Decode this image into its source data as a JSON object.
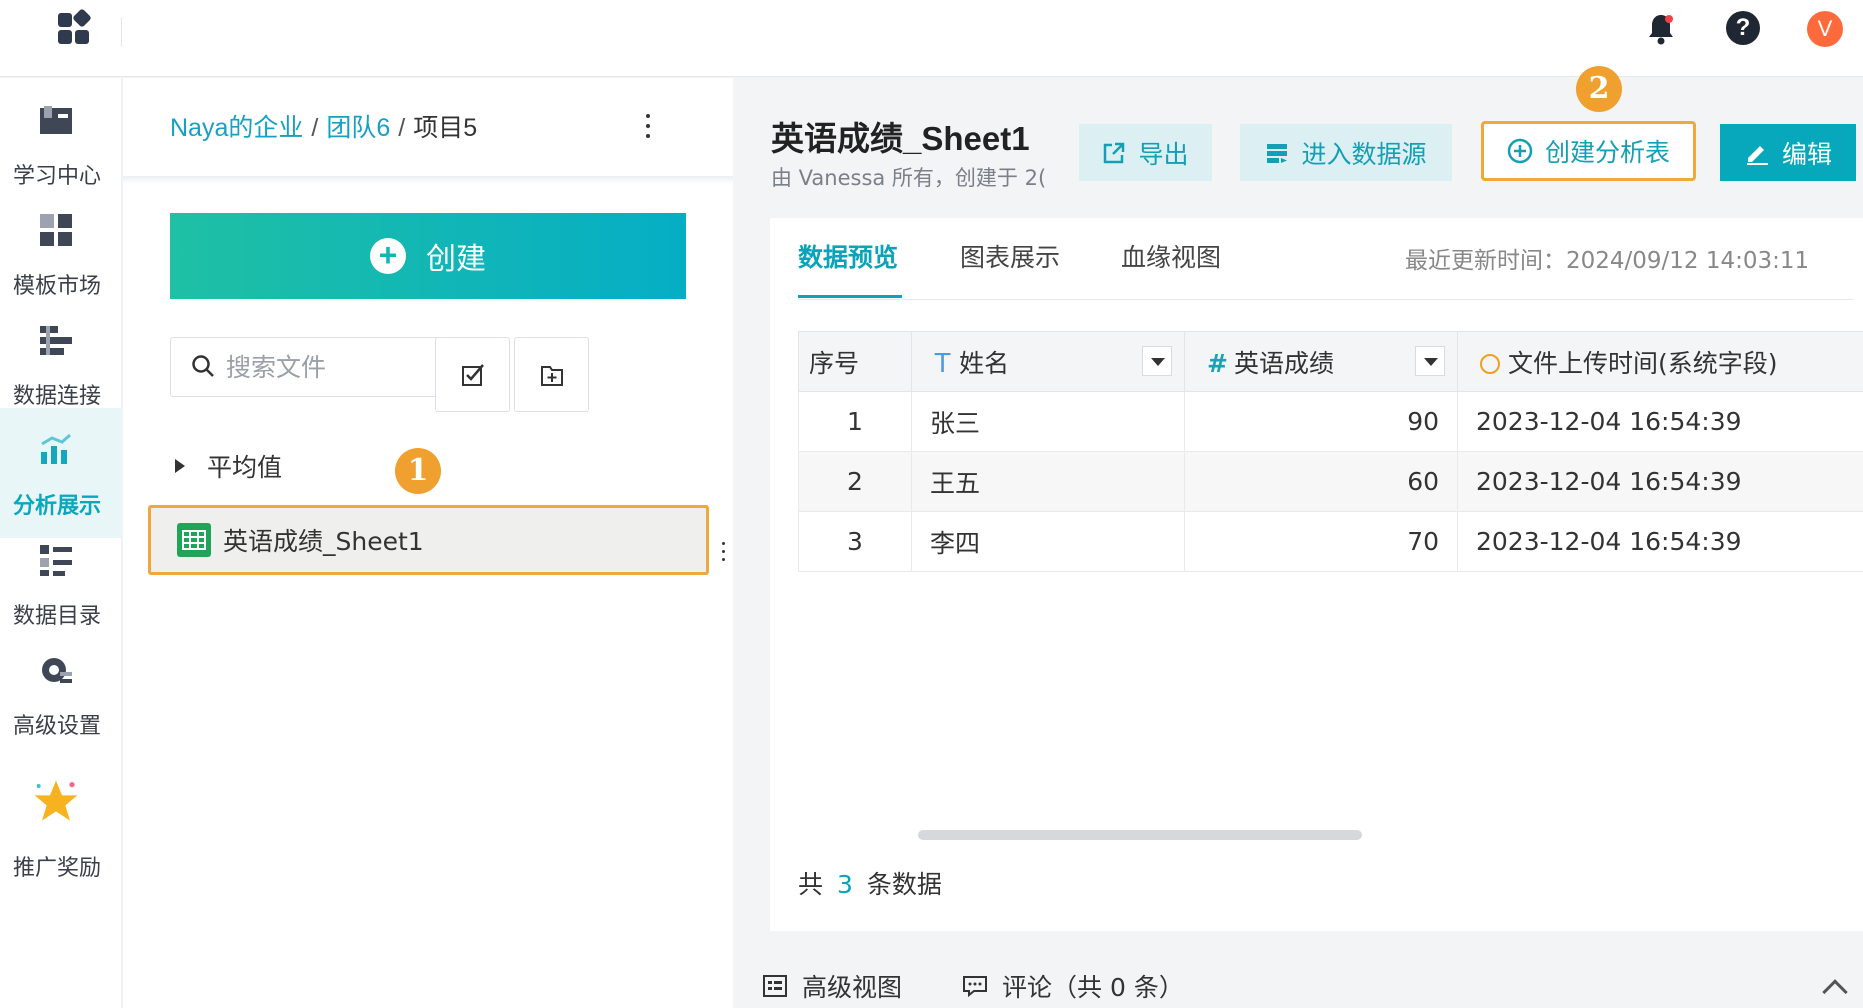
{
  "topbar": {
    "apps_icon": "grid-apps-icon",
    "bell_icon": "bell-icon",
    "help_icon": "question-icon",
    "help_glyph": "?",
    "avatar_letter": "V"
  },
  "leftnav": {
    "items": [
      {
        "label": "学习中心",
        "icon": "book-icon"
      },
      {
        "label": "模板市场",
        "icon": "template-icon"
      },
      {
        "label": "数据连接",
        "icon": "data-connect-icon"
      },
      {
        "label": "分析展示",
        "icon": "chart-icon",
        "active": true
      },
      {
        "label": "数据目录",
        "icon": "catalog-icon"
      },
      {
        "label": "高级设置",
        "icon": "settings-icon"
      },
      {
        "label": "推广奖励",
        "icon": "star-reward-icon"
      }
    ]
  },
  "filepanel": {
    "breadcrumb": [
      "Naya的企业",
      "团队6",
      "项目5"
    ],
    "breadcrumb_sep": "/",
    "create_label": "创建",
    "search_placeholder": "搜索文件",
    "folder_name": "平均值",
    "badge_1": "1",
    "file_name": "英语成绩_Sheet1"
  },
  "main": {
    "title": "英语成绩_Sheet1",
    "subtitle": "由 Vanessa 所有，创建于 2(",
    "actions": {
      "export": "导出",
      "enter_source": "进入数据源",
      "create_analysis": "创建分析表",
      "edit": "编辑"
    },
    "badge_2": "2",
    "tabs": [
      "数据预览",
      "图表展示",
      "血缘视图"
    ],
    "updated_text": "最近更新时间：2024/09/12 14:03:11",
    "table": {
      "headers": {
        "index": "序号",
        "name": "姓名",
        "name_type": "T",
        "score": "英语成绩",
        "score_type": "#",
        "upload": "文件上传时间(系统字段)"
      },
      "rows": [
        [
          "1",
          "张三",
          "90",
          "2023-12-04 16:54:39"
        ],
        [
          "2",
          "王五",
          "60",
          "2023-12-04 16:54:39"
        ],
        [
          "3",
          "李四",
          "70",
          "2023-12-04 16:54:39"
        ]
      ]
    },
    "count_prefix": "共",
    "count_value": "3",
    "count_suffix": "条数据"
  },
  "bottom": {
    "advanced_view": "高级视图",
    "comments": "评论（共 0 条）"
  }
}
